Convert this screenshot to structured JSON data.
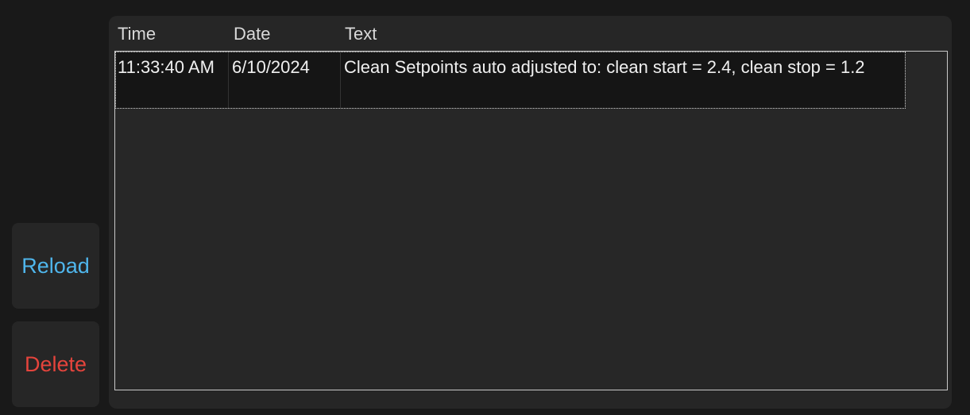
{
  "buttons": {
    "reload_label": "Reload",
    "delete_label": "Delete"
  },
  "log_table": {
    "columns": [
      "Time",
      "Date",
      "Text"
    ],
    "rows": [
      {
        "time": "11:33:40 AM",
        "date": "6/10/2024",
        "text": "Clean Setpoints auto adjusted to: clean start = 2.4, clean stop = 1.2"
      }
    ]
  },
  "colors": {
    "reload": "#4fb6ec",
    "delete": "#e5443c",
    "panel": "#262626",
    "background": "#191919"
  }
}
